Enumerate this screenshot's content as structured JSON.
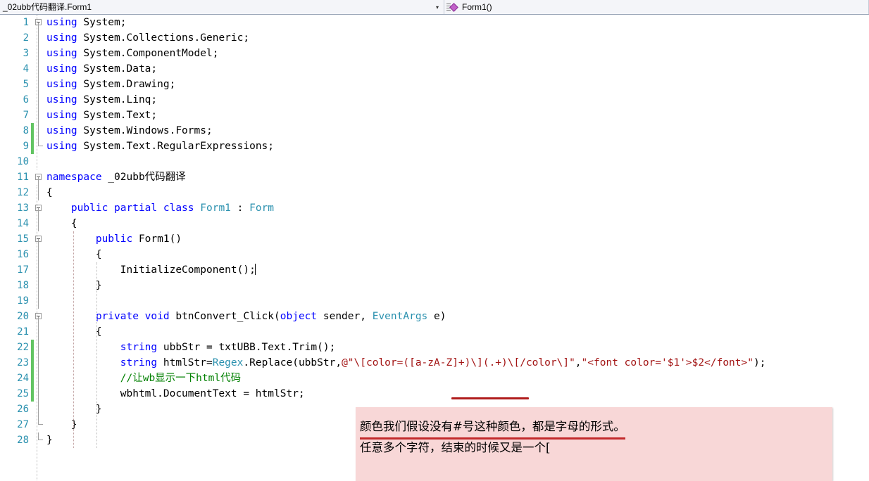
{
  "navbar": {
    "type_dropdown": {
      "value": "_02ubb代码翻译.Form1",
      "arrow": "chevron-down-icon"
    },
    "member_dropdown": {
      "value": "Form1()",
      "icon": "method-icon"
    }
  },
  "editor": {
    "lines": [
      {
        "num": "1",
        "changed": false,
        "fold": "open",
        "indent_guides": [],
        "tokens": [
          {
            "t": "using",
            "c": "kw"
          },
          {
            "t": " System;",
            "c": "plain"
          }
        ]
      },
      {
        "num": "2",
        "changed": false,
        "fold": "line",
        "indent_guides": [],
        "tokens": [
          {
            "t": "using",
            "c": "kw"
          },
          {
            "t": " System.Collections.Generic;",
            "c": "plain"
          }
        ]
      },
      {
        "num": "3",
        "changed": false,
        "fold": "line",
        "indent_guides": [],
        "tokens": [
          {
            "t": "using",
            "c": "kw"
          },
          {
            "t": " System.ComponentModel;",
            "c": "plain"
          }
        ]
      },
      {
        "num": "4",
        "changed": false,
        "fold": "line",
        "indent_guides": [],
        "tokens": [
          {
            "t": "using",
            "c": "kw"
          },
          {
            "t": " System.Data;",
            "c": "plain"
          }
        ]
      },
      {
        "num": "5",
        "changed": false,
        "fold": "line",
        "indent_guides": [],
        "tokens": [
          {
            "t": "using",
            "c": "kw"
          },
          {
            "t": " System.Drawing;",
            "c": "plain"
          }
        ]
      },
      {
        "num": "6",
        "changed": false,
        "fold": "line",
        "indent_guides": [],
        "tokens": [
          {
            "t": "using",
            "c": "kw"
          },
          {
            "t": " System.Linq;",
            "c": "plain"
          }
        ]
      },
      {
        "num": "7",
        "changed": false,
        "fold": "line",
        "indent_guides": [],
        "tokens": [
          {
            "t": "using",
            "c": "kw"
          },
          {
            "t": " System.Text;",
            "c": "plain"
          }
        ]
      },
      {
        "num": "8",
        "changed": true,
        "fold": "line",
        "indent_guides": [],
        "tokens": [
          {
            "t": "using",
            "c": "kw"
          },
          {
            "t": " System.Windows.Forms;",
            "c": "plain"
          }
        ]
      },
      {
        "num": "9",
        "changed": true,
        "fold": "endline",
        "indent_guides": [],
        "tokens": [
          {
            "t": "using",
            "c": "kw"
          },
          {
            "t": " System.Text.RegularExpressions;",
            "c": "plain"
          }
        ]
      },
      {
        "num": "10",
        "changed": false,
        "fold": "none",
        "indent_guides": [],
        "tokens": []
      },
      {
        "num": "11",
        "changed": false,
        "fold": "open",
        "indent_guides": [],
        "tokens": [
          {
            "t": "namespace",
            "c": "kw"
          },
          {
            "t": " _02ubb代码翻译",
            "c": "plain"
          }
        ]
      },
      {
        "num": "12",
        "changed": false,
        "fold": "line",
        "indent_guides": [],
        "tokens": [
          {
            "t": "{",
            "c": "plain"
          }
        ]
      },
      {
        "num": "13",
        "changed": false,
        "fold": "open2",
        "indent_guides": [],
        "tokens": [
          {
            "t": "    public partial class ",
            "c": "kw"
          },
          {
            "t": "Form1",
            "c": "type"
          },
          {
            "t": " : ",
            "c": "plain"
          },
          {
            "t": "Form",
            "c": "type"
          }
        ]
      },
      {
        "num": "14",
        "changed": false,
        "fold": "line",
        "indent_guides": [],
        "tokens": [
          {
            "t": "    {",
            "c": "plain"
          }
        ]
      },
      {
        "num": "15",
        "changed": false,
        "fold": "open2",
        "indent_guides": [],
        "tokens": [
          {
            "t": "        public",
            "c": "kw"
          },
          {
            "t": " Form1()",
            "c": "plain"
          }
        ]
      },
      {
        "num": "16",
        "changed": false,
        "fold": "line",
        "indent_guides": [],
        "tokens": [
          {
            "t": "        {",
            "c": "plain"
          }
        ]
      },
      {
        "num": "17",
        "changed": false,
        "fold": "line",
        "indent_guides": [],
        "caret": true,
        "tokens": [
          {
            "t": "            InitializeComponent();",
            "c": "plain"
          }
        ]
      },
      {
        "num": "18",
        "changed": false,
        "fold": "line",
        "indent_guides": [],
        "tokens": [
          {
            "t": "        }",
            "c": "plain"
          }
        ]
      },
      {
        "num": "19",
        "changed": false,
        "fold": "line",
        "indent_guides": [],
        "tokens": []
      },
      {
        "num": "20",
        "changed": false,
        "fold": "open2",
        "indent_guides": [],
        "tokens": [
          {
            "t": "        private void",
            "c": "kw"
          },
          {
            "t": " btnConvert_Click(",
            "c": "plain"
          },
          {
            "t": "object",
            "c": "kw"
          },
          {
            "t": " sender, ",
            "c": "plain"
          },
          {
            "t": "EventArgs",
            "c": "type"
          },
          {
            "t": " e)",
            "c": "plain"
          }
        ]
      },
      {
        "num": "21",
        "changed": false,
        "fold": "line",
        "indent_guides": [],
        "tokens": [
          {
            "t": "        {",
            "c": "plain"
          }
        ]
      },
      {
        "num": "22",
        "changed": true,
        "fold": "line",
        "indent_guides": [],
        "tokens": [
          {
            "t": "            string",
            "c": "kw"
          },
          {
            "t": " ubbStr = txtUBB.Text.Trim();",
            "c": "plain"
          }
        ]
      },
      {
        "num": "23",
        "changed": true,
        "fold": "line",
        "indent_guides": [],
        "tokens": [
          {
            "t": "            string",
            "c": "kw"
          },
          {
            "t": " htmlStr=",
            "c": "plain"
          },
          {
            "t": "Regex",
            "c": "type"
          },
          {
            "t": ".Replace(ubbStr,",
            "c": "plain"
          },
          {
            "t": "@\"\\[color=([a-zA-Z]+)\\](.+)\\[/color\\]\"",
            "c": "str"
          },
          {
            "t": ",",
            "c": "plain"
          },
          {
            "t": "\"<font color='$1'>$2</font>\"",
            "c": "str"
          },
          {
            "t": ");",
            "c": "plain"
          }
        ]
      },
      {
        "num": "24",
        "changed": true,
        "fold": "line",
        "indent_guides": [],
        "tokens": [
          {
            "t": "            //让wb显示一下html代码",
            "c": "cmt"
          }
        ]
      },
      {
        "num": "25",
        "changed": true,
        "fold": "line",
        "indent_guides": [],
        "tokens": [
          {
            "t": "            wbhtml.DocumentText = htmlStr;",
            "c": "plain"
          }
        ]
      },
      {
        "num": "26",
        "changed": false,
        "fold": "line",
        "indent_guides": [],
        "tokens": [
          {
            "t": "        }",
            "c": "plain"
          }
        ]
      },
      {
        "num": "27",
        "changed": false,
        "fold": "endline",
        "indent_guides": [],
        "tokens": [
          {
            "t": "    }",
            "c": "plain"
          }
        ]
      },
      {
        "num": "28",
        "changed": false,
        "fold": "endline",
        "indent_guides": [],
        "tokens": [
          {
            "t": "}",
            "c": "plain"
          }
        ]
      }
    ]
  },
  "annotations": {
    "regex_underline": {
      "target": "([a-zA-Z]+)",
      "color": "#b01c1c"
    },
    "note_box": {
      "background": "#f8d7d7",
      "lines": [
        {
          "text": "颜色我们假设没有#号这种颜色，都是字母的形式。",
          "underlined": true
        },
        {
          "text": "任意多个字符，结束的时候又是一个[",
          "underlined": false
        }
      ]
    }
  },
  "theme": {
    "keyword_color": "#0000ff",
    "type_color": "#2b91af",
    "string_color": "#a31515",
    "comment_color": "#008000",
    "line_number_color": "#2b91af",
    "change_saved_color": "#62c462",
    "annotation_red": "#c2292b"
  }
}
